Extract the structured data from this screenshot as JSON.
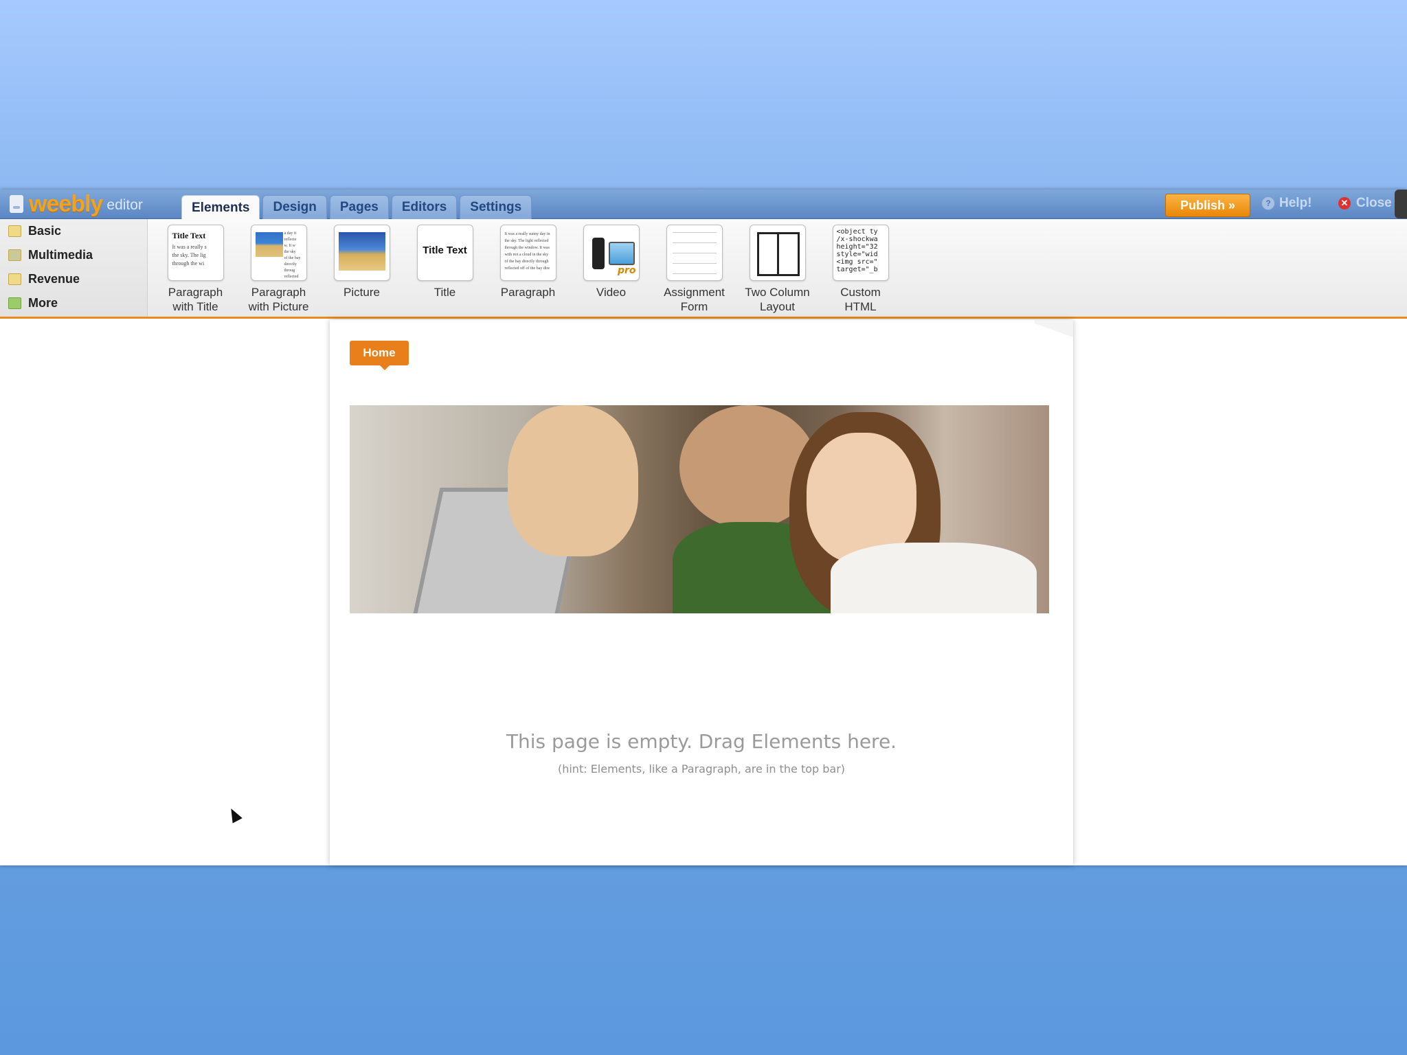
{
  "app": {
    "brand": "weebly",
    "sub": "editor"
  },
  "tabs": [
    {
      "label": "Elements",
      "active": true
    },
    {
      "label": "Design",
      "active": false
    },
    {
      "label": "Pages",
      "active": false
    },
    {
      "label": "Editors",
      "active": false
    },
    {
      "label": "Settings",
      "active": false
    }
  ],
  "actions": {
    "publish": "Publish »",
    "help": "Help!",
    "close": "Close"
  },
  "categories": [
    "Basic",
    "Multimedia",
    "Revenue",
    "More"
  ],
  "elements": [
    {
      "label": "Paragraph\nwith Title",
      "thumb_title": "Title Text",
      "thumb_text": "It was a really s\nthe sky. The lig\nthrough the wi"
    },
    {
      "label": "Paragraph\nwith Picture",
      "thumb_text": "a day it\nreflecte\nw. It w\nthe sky\nof the bay directly throug\nreflected off of the bay di"
    },
    {
      "label": "Picture"
    },
    {
      "label": "Title",
      "thumb_title": "Title Text"
    },
    {
      "label": "Paragraph",
      "thumb_text": "It was a really sunny day in\nthe sky. The light reflected\nthrough the window. It was\nwith not a cloud in the sky\nof the bay directly through\nreflected off of the bay dire"
    },
    {
      "label": "Video",
      "badge": "pro"
    },
    {
      "label": "Assignment\nForm"
    },
    {
      "label": "Two Column\nLayout"
    },
    {
      "label": "Custom\nHTML",
      "thumb_code": "<object ty\n/x-shockwa\nheight=\"32\nstyle=\"wid\n<img src=\"\ntarget=\"_b"
    }
  ],
  "page": {
    "nav_home": "Home",
    "empty_message": "This page is empty. Drag Elements here.",
    "empty_hint": "(hint: Elements, like a Paragraph, are in the top bar)"
  },
  "colors": {
    "accent": "#e97f1b",
    "topbar": "#5b86c3",
    "background": "#7aabea"
  }
}
